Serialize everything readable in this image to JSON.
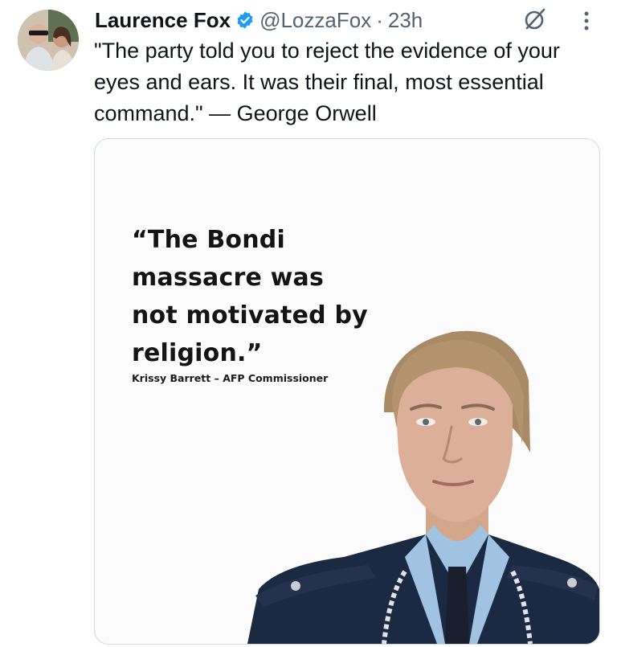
{
  "tweet": {
    "author": {
      "display_name": "Laurence Fox",
      "verified_icon": "verified-badge-icon",
      "handle": "@LozzaFox",
      "separator": "·",
      "time": "23h"
    },
    "text": "\"The party told you to reject the evidence of your eyes and ears. It was their final, most essential command.\" — George Orwell",
    "actions": {
      "grok_icon": "grok-icon",
      "more_icon": "more-vertical-icon"
    },
    "media": {
      "quote": "“The Bondi massacre was not motivated by religion.”",
      "attribution": "Krissy Barrett – AFP Commissioner"
    }
  },
  "colors": {
    "verified": "#1d9bf0",
    "secondary_text": "#536471",
    "primary_text": "#0f1419",
    "media_border": "#cfd9de"
  }
}
